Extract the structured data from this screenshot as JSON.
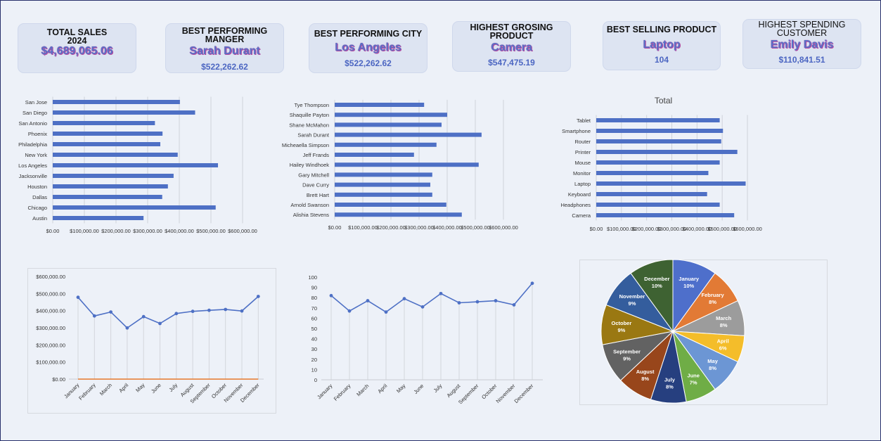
{
  "kpis": {
    "total_sales": {
      "title": "TOTAL SALES",
      "subtitle": "2024",
      "value": "$4,689,065.06"
    },
    "best_manager": {
      "title": "BEST PERFORMING MANGER",
      "name": "Sarah Durant",
      "value": "$522,262.62"
    },
    "best_city": {
      "title": "BEST PERFORMING CITY",
      "name": "Los Angeles",
      "value": "$522,262.62"
    },
    "top_product": {
      "title": "HIGHEST GROSING PRODUCT",
      "name": "Camera",
      "value": "$547,475.19"
    },
    "best_selling": {
      "title": "BEST SELLING PRODUCT",
      "name": "Laptop",
      "value": "104"
    },
    "top_customer": {
      "title": "HIGHEST SPENDING CUSTOMER",
      "name": "Emily Davis",
      "value": "$110,841.51"
    }
  },
  "colors": {
    "bar": "#4e70c5",
    "line": "#4e70c5",
    "zero_line": "#e6782a",
    "grid": "#d6d9df"
  },
  "chart_data": [
    {
      "type": "bar",
      "orientation": "horizontal",
      "name": "sales-by-city",
      "categories": [
        "San Jose",
        "San Diego",
        "San Antonio",
        "Phoenix",
        "Philadelphia",
        "New York",
        "Los Angeles",
        "Jacksonville",
        "Houston",
        "Dallas",
        "Chicago",
        "Austin"
      ],
      "values": [
        402000,
        450000,
        323000,
        347000,
        340000,
        395000,
        522262.62,
        382000,
        364000,
        346000,
        515000,
        287000
      ],
      "xlim": [
        0,
        600000
      ],
      "xticks": [
        "$0.00",
        "$100,000.00",
        "$200,000.00",
        "$300,000.00",
        "$400,000.00",
        "$500,000.00",
        "$600,000.00"
      ],
      "grid": true
    },
    {
      "type": "bar",
      "orientation": "horizontal",
      "name": "sales-by-manager",
      "categories": [
        "Tye Thompson",
        "Shaquille Payton",
        "Shane McMahon",
        "Sarah Durant",
        "Micheaella Simpson",
        "Jeff Frands",
        "Hailey Windhoek",
        "Gary Mitchell",
        "Dave Curry",
        "Brett Hart",
        "Arnold Swanson",
        "Alishia Stevens"
      ],
      "values": [
        318000,
        400000,
        380000,
        522262.62,
        362000,
        282000,
        512000,
        347000,
        340000,
        347000,
        397000,
        452000
      ],
      "xlim": [
        0,
        600000
      ],
      "xticks": [
        "$0.00",
        "$100,000.00",
        "$200,000.00",
        "$300,000.00",
        "$400,000.00",
        "$500,000.00",
        "$600,000.00"
      ],
      "grid": true
    },
    {
      "type": "bar",
      "orientation": "horizontal",
      "name": "sales-by-product",
      "title": "Total",
      "categories": [
        "Tablet",
        "Smartphone",
        "Router",
        "Printer",
        "Mouse",
        "Monitor",
        "Laptop",
        "Keyboard",
        "Headphones",
        "Camera"
      ],
      "values": [
        490000,
        503000,
        496000,
        560000,
        490000,
        445000,
        593000,
        440000,
        490000,
        547475.19
      ],
      "xlim": [
        0,
        600000
      ],
      "xticks": [
        "$0.00",
        "$100,000.00",
        "$200,000.00",
        "$300,000.00",
        "$400,000.00",
        "$500,000.00",
        "$600,000.00"
      ],
      "grid": true
    },
    {
      "type": "line",
      "name": "monthly-sales",
      "categories": [
        "January",
        "February",
        "March",
        "April",
        "May",
        "June",
        "July",
        "August",
        "September",
        "October",
        "November",
        "December"
      ],
      "values": [
        478000,
        369000,
        392000,
        299000,
        365000,
        325000,
        383000,
        396000,
        402000,
        407000,
        398000,
        483000
      ],
      "ylim": [
        0,
        600000
      ],
      "yticks": [
        "$0.00",
        "$100,000.00",
        "$200,000.00",
        "$300,000.00",
        "$400,000.00",
        "$500,000.00",
        "$600,000.00"
      ],
      "second_series_values": [
        0,
        0,
        0,
        0,
        0,
        0,
        0,
        0,
        0,
        0,
        0,
        0
      ]
    },
    {
      "type": "line",
      "name": "monthly-units",
      "categories": [
        "January",
        "February",
        "March",
        "April",
        "May",
        "June",
        "July",
        "August",
        "September",
        "October",
        "November",
        "December"
      ],
      "values": [
        82,
        67,
        77,
        66,
        79,
        71,
        84,
        75,
        76,
        77,
        73,
        94
      ],
      "ylim": [
        0,
        100
      ],
      "yticks": [
        "0",
        "10",
        "20",
        "30",
        "40",
        "50",
        "60",
        "70",
        "80",
        "90",
        "100"
      ]
    },
    {
      "type": "pie",
      "name": "monthly-share",
      "slices": [
        {
          "label": "January",
          "pct": 10,
          "text": "10%",
          "color": "#4e6fcb"
        },
        {
          "label": "February",
          "pct": 8,
          "text": "8%",
          "color": "#e27a35"
        },
        {
          "label": "March",
          "pct": 8,
          "text": "8%",
          "color": "#9c9c9c"
        },
        {
          "label": "April",
          "pct": 6,
          "text": "6%",
          "color": "#f4bd2a"
        },
        {
          "label": "May",
          "pct": 8,
          "text": "8%",
          "color": "#6c96d4"
        },
        {
          "label": "June",
          "pct": 7,
          "text": "7%",
          "color": "#6fad46"
        },
        {
          "label": "July",
          "pct": 8,
          "text": "8%",
          "color": "#263f7f"
        },
        {
          "label": "August",
          "pct": 8,
          "text": "8%",
          "color": "#98461b"
        },
        {
          "label": "September",
          "pct": 9,
          "text": "9%",
          "color": "#626262"
        },
        {
          "label": "October",
          "pct": 9,
          "text": "9%",
          "color": "#9a7812"
        },
        {
          "label": "November",
          "pct": 9,
          "text": "9%",
          "color": "#345d9d"
        },
        {
          "label": "December",
          "pct": 10,
          "text": "10%",
          "color": "#3e6232"
        }
      ]
    }
  ]
}
